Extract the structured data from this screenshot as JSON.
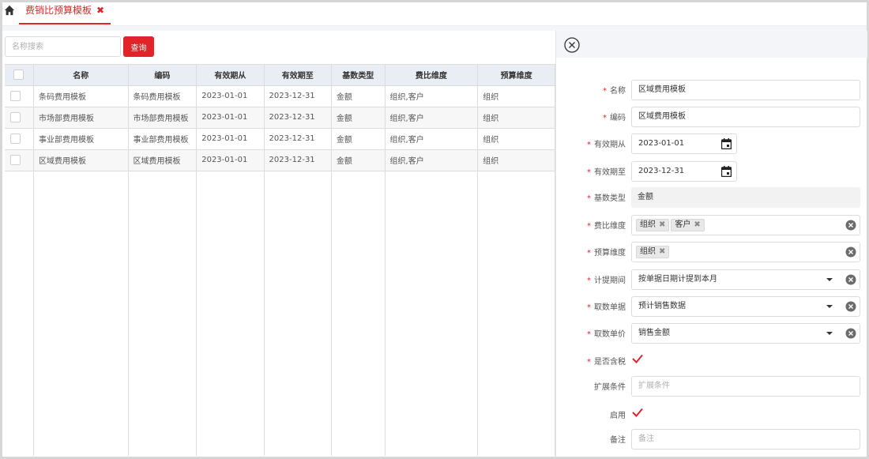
{
  "tab": {
    "title": "费销比预算模板",
    "close_glyph": "✖"
  },
  "search": {
    "placeholder": "名称搜索",
    "button": "查询"
  },
  "table": {
    "headers": [
      "名称",
      "编码",
      "有效期从",
      "有效期至",
      "基数类型",
      "费比维度",
      "预算维度"
    ],
    "rows": [
      [
        "条码费用模板",
        "条码费用模板",
        "2023-01-01",
        "2023-12-31",
        "金额",
        "组织,客户",
        "组织"
      ],
      [
        "市场部费用模板",
        "市场部费用模板",
        "2023-01-01",
        "2023-12-31",
        "金额",
        "组织,客户",
        "组织"
      ],
      [
        "事业部费用模板",
        "事业部费用模板",
        "2023-01-01",
        "2023-12-31",
        "金额",
        "组织,客户",
        "组织"
      ],
      [
        "区域费用模板",
        "区域费用模板",
        "2023-01-01",
        "2023-12-31",
        "金额",
        "组织,客户",
        "组织"
      ]
    ]
  },
  "form": {
    "name": {
      "label": "名称",
      "value": "区域费用模板"
    },
    "code": {
      "label": "编码",
      "value": "区域费用模板"
    },
    "valid_from": {
      "label": "有效期从",
      "value": "2023-01-01"
    },
    "valid_to": {
      "label": "有效期至",
      "value": "2023-12-31"
    },
    "base_type": {
      "label": "基数类型",
      "value": "金额"
    },
    "cost_dims": {
      "label": "费比维度",
      "tags": [
        "组织",
        "客户"
      ]
    },
    "budget_dims": {
      "label": "预算维度",
      "tags": [
        "组织"
      ]
    },
    "accrual_period": {
      "label": "计提期间",
      "value": "按单据日期计提到本月"
    },
    "source_doc": {
      "label": "取数单据",
      "value": "预计销售数据"
    },
    "source_price": {
      "label": "取数单价",
      "value": "销售金额"
    },
    "tax_included": {
      "label": "是否含税",
      "checked": true
    },
    "ext_cond": {
      "label": "扩展条件",
      "placeholder": "扩展条件"
    },
    "enabled": {
      "label": "启用",
      "checked": true
    },
    "remark": {
      "label": "备注",
      "placeholder": "备注"
    },
    "required_mark": "*",
    "tag_remove_glyph": "✖"
  },
  "colors": {
    "accent": "#e0242a",
    "header_bg": "#e9edf4"
  }
}
